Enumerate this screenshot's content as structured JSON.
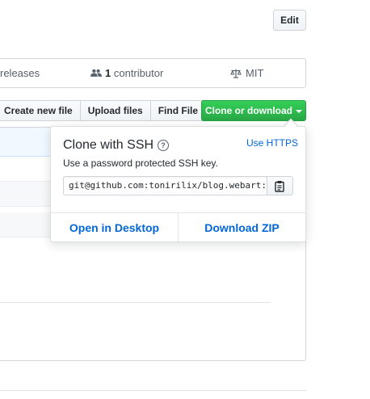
{
  "header": {
    "edit_label": "Edit"
  },
  "summary": {
    "releases_label": "releases",
    "contributors_count": "1",
    "contributors_label": "contributor",
    "license_label": "MIT"
  },
  "file_actions": {
    "create_new_file": "Create new file",
    "upload_files": "Upload files",
    "find_file": "Find File",
    "clone_or_download": "Clone or download"
  },
  "clone_popover": {
    "title": "Clone with SSH",
    "help_glyph": "?",
    "switch_link": "Use HTTPS",
    "description": "Use a password protected SSH key.",
    "clone_url": "git@github.com:tonirilix/blog.webart:",
    "open_in_desktop": "Open in Desktop",
    "download_zip": "Download ZIP"
  },
  "colors": {
    "primary_green": "#28a745",
    "link_blue": "#0366d6"
  },
  "icons": [
    "people-icon",
    "law-icon",
    "question-icon",
    "clipboard-icon",
    "caret-down-icon"
  ]
}
